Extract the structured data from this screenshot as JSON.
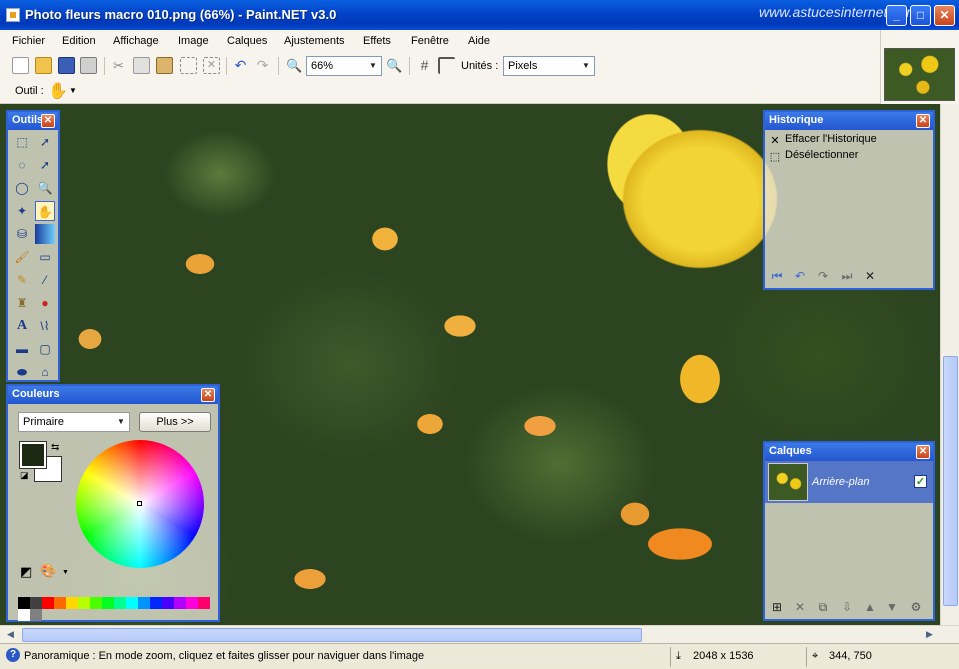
{
  "window": {
    "title": "Photo fleurs macro 010.png (66%) - Paint.NET v3.0",
    "watermark": "www.astucesinternet.com",
    "buttons": {
      "minimize": "_",
      "maximize": "□",
      "close": "✕"
    }
  },
  "menu": [
    "Fichier",
    "Edition",
    "Affichage",
    "Image",
    "Calques",
    "Ajustements",
    "Effets",
    "Fenêtre",
    "Aide"
  ],
  "toolbar": {
    "zoom_value": "66%",
    "units_label": "Unités :",
    "units_value": "Pixels",
    "tool_label": "Outil :"
  },
  "tools_panel": {
    "title": "Outils",
    "tools": [
      "rectangle-select",
      "move-selection",
      "lasso-select",
      "move-selected",
      "ellipse-select",
      "zoom",
      "magic-wand",
      "pan",
      "paint-bucket",
      "gradient",
      "paintbrush",
      "eraser",
      "pencil",
      "color-picker",
      "clone-stamp",
      "recolor",
      "text",
      "line-curve",
      "rectangle",
      "rounded-rectangle",
      "ellipse",
      "freeform-shape"
    ]
  },
  "colors_panel": {
    "title": "Couleurs",
    "mode_value": "Primaire",
    "more_button": "Plus >>",
    "palette": [
      "#000000",
      "#404040",
      "#ff0000",
      "#ff6a00",
      "#ffd800",
      "#b6ff00",
      "#4cff00",
      "#00ff21",
      "#00ff90",
      "#00ffff",
      "#0094ff",
      "#0026ff",
      "#4800ff",
      "#b200ff",
      "#ff00dc",
      "#ff006e",
      "#ffffff",
      "#808080"
    ]
  },
  "history_panel": {
    "title": "Historique",
    "items": [
      "Effacer l'Historique",
      "Désélectionner"
    ]
  },
  "layers_panel": {
    "title": "Calques",
    "layer_name": "Arrière-plan"
  },
  "status": {
    "message": "Panoramique : En mode zoom, cliquez et faites glisser pour naviguer dans l'image",
    "image_size": "2048 x 1536",
    "cursor_pos": "344, 750"
  }
}
